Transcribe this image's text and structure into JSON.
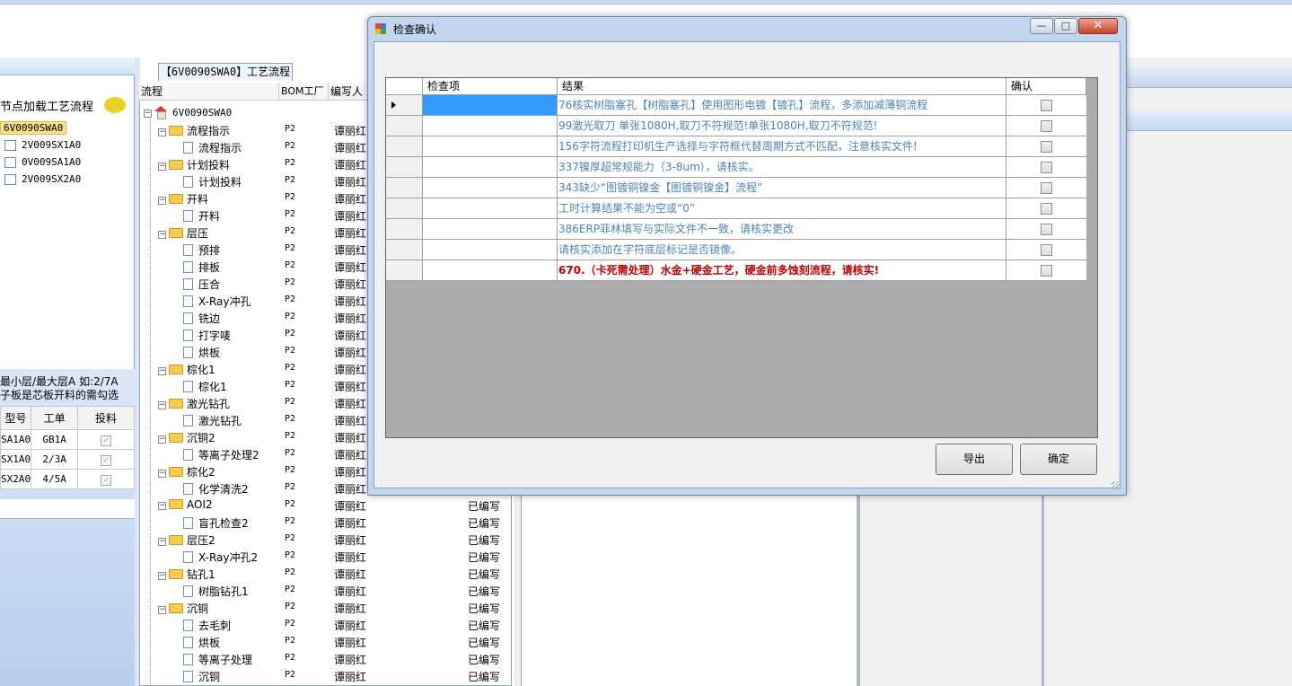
{
  "left_panel": {
    "title": "节点加载工艺流程",
    "nodes": [
      "6V0090SWA0",
      "2V009SX1A0",
      "0V009SA1A0",
      "2V009SX2A0"
    ],
    "note_line1": "最小层/最大层A 如:2/7A",
    "note_line2": "子板是芯板开料的需勾选",
    "table": {
      "headers": [
        "型号",
        "工单",
        "投料"
      ],
      "rows": [
        {
          "model": "SA1A0",
          "order": "GB1A"
        },
        {
          "model": "SX1A0",
          "order": "2/3A"
        },
        {
          "model": "SX2A0",
          "order": "4/5A"
        }
      ]
    }
  },
  "process_tab": "【6V0090SWA0】工艺流程",
  "tree": {
    "headers": [
      "流程",
      "BOM工厂",
      "编写人"
    ],
    "root": "6V0090SWA0",
    "rows": [
      {
        "name": "流程指示",
        "level": 1,
        "folder": true,
        "bom": "P2",
        "author": "谭丽红",
        "status": ""
      },
      {
        "name": "流程指示",
        "level": 2,
        "folder": false,
        "bom": "P2",
        "author": "谭丽红",
        "status": ""
      },
      {
        "name": "计划投料",
        "level": 1,
        "folder": true,
        "bom": "P2",
        "author": "谭丽红",
        "status": ""
      },
      {
        "name": "计划投料",
        "level": 2,
        "folder": false,
        "bom": "P2",
        "author": "谭丽红",
        "status": ""
      },
      {
        "name": "开料",
        "level": 1,
        "folder": true,
        "bom": "P2",
        "author": "谭丽红",
        "status": ""
      },
      {
        "name": "开料",
        "level": 2,
        "folder": false,
        "bom": "P2",
        "author": "谭丽红",
        "status": ""
      },
      {
        "name": "层压",
        "level": 1,
        "folder": true,
        "bom": "P2",
        "author": "谭丽红",
        "status": ""
      },
      {
        "name": "预排",
        "level": 2,
        "folder": false,
        "bom": "P2",
        "author": "谭丽红",
        "status": ""
      },
      {
        "name": "排板",
        "level": 2,
        "folder": false,
        "bom": "P2",
        "author": "谭丽红",
        "status": ""
      },
      {
        "name": "压合",
        "level": 2,
        "folder": false,
        "bom": "P2",
        "author": "谭丽红",
        "status": ""
      },
      {
        "name": "X-Ray冲孔",
        "level": 2,
        "folder": false,
        "bom": "P2",
        "author": "谭丽红",
        "status": ""
      },
      {
        "name": "铣边",
        "level": 2,
        "folder": false,
        "bom": "P2",
        "author": "谭丽红",
        "status": ""
      },
      {
        "name": "打字唛",
        "level": 2,
        "folder": false,
        "bom": "P2",
        "author": "谭丽红",
        "status": ""
      },
      {
        "name": "烘板",
        "level": 2,
        "folder": false,
        "bom": "P2",
        "author": "谭丽红",
        "status": ""
      },
      {
        "name": "棕化1",
        "level": 1,
        "folder": true,
        "bom": "P2",
        "author": "谭丽红",
        "status": ""
      },
      {
        "name": "棕化1",
        "level": 2,
        "folder": false,
        "bom": "P2",
        "author": "谭丽红",
        "status": ""
      },
      {
        "name": "激光钻孔",
        "level": 1,
        "folder": true,
        "bom": "P2",
        "author": "谭丽红",
        "status": ""
      },
      {
        "name": "激光钻孔",
        "level": 2,
        "folder": false,
        "bom": "P2",
        "author": "谭丽红",
        "status": ""
      },
      {
        "name": "沉铜2",
        "level": 1,
        "folder": true,
        "bom": "P2",
        "author": "谭丽红",
        "status": ""
      },
      {
        "name": "等离子处理2",
        "level": 2,
        "folder": false,
        "bom": "P2",
        "author": "谭丽红",
        "status": ""
      },
      {
        "name": "棕化2",
        "level": 1,
        "folder": true,
        "bom": "P2",
        "author": "谭丽红",
        "status": ""
      },
      {
        "name": "化学清洗2",
        "level": 2,
        "folder": false,
        "bom": "P2",
        "author": "谭丽红",
        "status": ""
      },
      {
        "name": "AOI2",
        "level": 1,
        "folder": true,
        "bom": "P2",
        "author": "谭丽红",
        "status": "已编写"
      },
      {
        "name": "盲孔检查2",
        "level": 2,
        "folder": false,
        "bom": "P2",
        "author": "谭丽红",
        "status": "已编写"
      },
      {
        "name": "层压2",
        "level": 1,
        "folder": true,
        "bom": "P2",
        "author": "谭丽红",
        "status": "已编写"
      },
      {
        "name": "X-Ray冲孔2",
        "level": 2,
        "folder": false,
        "bom": "P2",
        "author": "谭丽红",
        "status": "已编写"
      },
      {
        "name": "钻孔1",
        "level": 1,
        "folder": true,
        "bom": "P2",
        "author": "谭丽红",
        "status": "已编写"
      },
      {
        "name": "树脂钻孔1",
        "level": 2,
        "folder": false,
        "bom": "P2",
        "author": "谭丽红",
        "status": "已编写"
      },
      {
        "name": "沉铜",
        "level": 1,
        "folder": true,
        "bom": "P2",
        "author": "谭丽红",
        "status": "已编写"
      },
      {
        "name": "去毛刺",
        "level": 2,
        "folder": false,
        "bom": "P2",
        "author": "谭丽红",
        "status": "已编写"
      },
      {
        "name": "烘板",
        "level": 2,
        "folder": false,
        "bom": "P2",
        "author": "谭丽红",
        "status": "已编写"
      },
      {
        "name": "等离子处理",
        "level": 2,
        "folder": false,
        "bom": "P2",
        "author": "谭丽红",
        "status": "已编写"
      },
      {
        "name": "沉铜",
        "level": 2,
        "folder": false,
        "bom": "P2",
        "author": "谭丽红",
        "status": "已编写"
      }
    ]
  },
  "dialog": {
    "title": "检查确认",
    "columns": [
      "检查项",
      "结果",
      "确认"
    ],
    "rows": [
      {
        "result": "76核实树脂塞孔【树脂塞孔】使用图形电镀【镀孔】流程，多添加减薄铜流程",
        "red": false
      },
      {
        "result": "99激光取刀 单张1080H,取刀不符规范!单张1080H,取刀不符规范!",
        "red": false
      },
      {
        "result": "156字符流程打印机生产选择与字符框代替周期方式不匹配，注意核实文件!",
        "red": false
      },
      {
        "result": "337镍厚超常规能力（3-8um），请核实。",
        "red": false
      },
      {
        "result": "343缺少“图镀铜镍金【图镀铜镍金】流程”",
        "red": false
      },
      {
        "result": "工时计算结果不能为空或“0”",
        "red": false
      },
      {
        "result": "386ERP菲林填写与实际文件不一致，请核实更改",
        "red": false
      },
      {
        "result": "请核实添加在字符底层标记是否镜像。",
        "red": false
      },
      {
        "result": "670.（卡死需处理）水金+硬金工艺，硬金前多蚀刻流程，请核实!",
        "red": true
      }
    ],
    "export_label": "导出",
    "ok_label": "确定",
    "minimize": "—",
    "maximize": "□",
    "close": "✕"
  },
  "colors": {
    "accent": "#3399ff",
    "link_text": "#4f83b6",
    "error_text": "#c00000"
  }
}
